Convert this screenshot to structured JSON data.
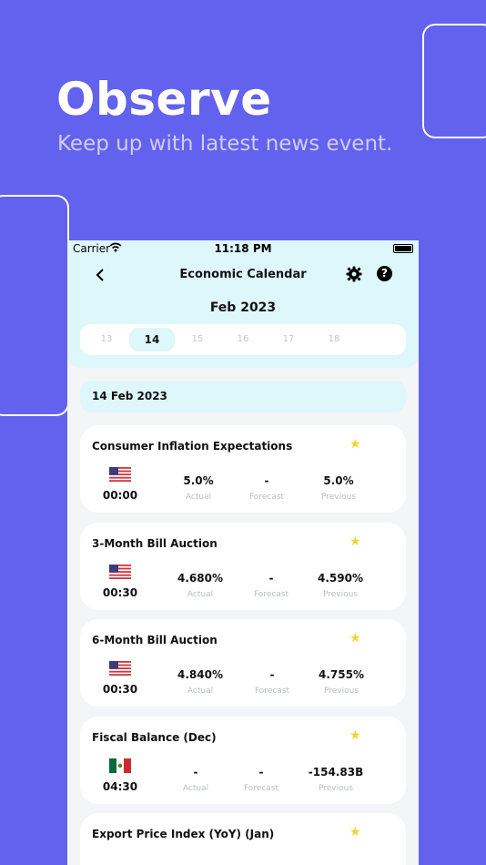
{
  "promo": {
    "headline": "Observe",
    "subline": "Keep up with latest news event."
  },
  "status_bar": {
    "carrier": "Carrier",
    "time": "11:18 PM"
  },
  "nav": {
    "title": "Economic Calendar",
    "help_label": "?"
  },
  "calendar": {
    "month_label": "Feb 2023",
    "days": [
      "13",
      "14",
      "15",
      "16",
      "17",
      "18"
    ],
    "selected_day": "14"
  },
  "list": {
    "date_header": "14 Feb 2023",
    "labels": {
      "actual": "Actual",
      "forecast": "Forecast",
      "previous": "Previous"
    },
    "events": [
      {
        "title": "Consumer Inflation Expectations",
        "time": "00:00",
        "country": "us-flag-icon",
        "actual": "5.0%",
        "forecast": "-",
        "previous": "5.0%"
      },
      {
        "title": "3-Month Bill Auction",
        "time": "00:30",
        "country": "us-flag-icon",
        "actual": "4.680%",
        "forecast": "-",
        "previous": "4.590%"
      },
      {
        "title": "6-Month Bill Auction",
        "time": "00:30",
        "country": "us-flag-icon",
        "actual": "4.840%",
        "forecast": "-",
        "previous": "4.755%"
      },
      {
        "title": "Fiscal Balance (Dec)",
        "time": "04:30",
        "country": "mexico-flag-icon",
        "actual": "-",
        "forecast": "-",
        "previous": "-154.83B"
      },
      {
        "title": "Export Price Index (YoY) (Jan)",
        "time": "",
        "country": "",
        "actual": "",
        "forecast": "",
        "previous": ""
      }
    ]
  },
  "colors": {
    "background": "#6362ee",
    "header_band": "#def7fb",
    "star": "#f6d32d"
  }
}
